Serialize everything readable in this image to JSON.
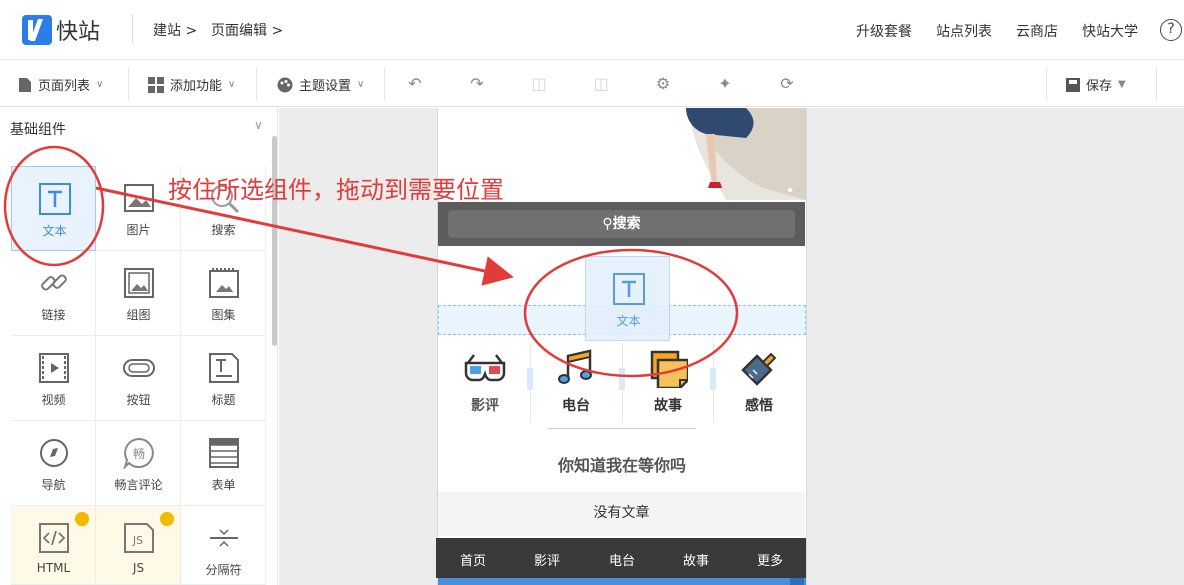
{
  "app": {
    "logo_text": "快站"
  },
  "breadcrumb": {
    "items": [
      "建站 >",
      "页面编辑 >"
    ]
  },
  "topnav": {
    "items": [
      "升级套餐",
      "站点列表",
      "云商店",
      "快站大学"
    ],
    "help": "?"
  },
  "toolbar": {
    "page_list": "页面列表",
    "add_feature": "添加功能",
    "theme_settings": "主题设置",
    "save": "保存",
    "icons": [
      "undo-icon",
      "redo-icon",
      "copy-icon",
      "paste-icon",
      "gear-icon",
      "plugin-icon",
      "share-icon"
    ]
  },
  "panel": {
    "title": "基础组件",
    "components": [
      {
        "label": "文本",
        "icon": "text-icon"
      },
      {
        "label": "图片",
        "icon": "image-icon"
      },
      {
        "label": "搜索",
        "icon": "search-icon"
      },
      {
        "label": "链接",
        "icon": "link-icon"
      },
      {
        "label": "组图",
        "icon": "gallery-icon"
      },
      {
        "label": "图集",
        "icon": "album-icon"
      },
      {
        "label": "视频",
        "icon": "video-icon"
      },
      {
        "label": "按钮",
        "icon": "button-icon"
      },
      {
        "label": "标题",
        "icon": "heading-icon"
      },
      {
        "label": "导航",
        "icon": "compass-icon"
      },
      {
        "label": "畅言评论",
        "icon": "comment-icon",
        "badge": "畅"
      },
      {
        "label": "表单",
        "icon": "form-icon"
      },
      {
        "label": "HTML",
        "icon": "code-icon",
        "vip": true
      },
      {
        "label": "JS",
        "icon": "js-icon",
        "vip": true
      },
      {
        "label": "分隔符",
        "icon": "divider-icon"
      }
    ]
  },
  "annotation": {
    "text": "按住所选组件，拖动到需要位置",
    "color": "#e23b3b"
  },
  "preview": {
    "search_label": "搜索",
    "drag_label": "文本",
    "categories": [
      "影评",
      "电台",
      "故事",
      "感悟"
    ],
    "headline": "你知道我在等你吗",
    "no_article": "没有文章",
    "bottom_nav": [
      "首页",
      "影评",
      "电台",
      "故事",
      "更多"
    ]
  },
  "colors": {
    "accent": "#2b7de9",
    "annotation": "#e23b3b",
    "nav_bg": "#3a3a3a"
  }
}
